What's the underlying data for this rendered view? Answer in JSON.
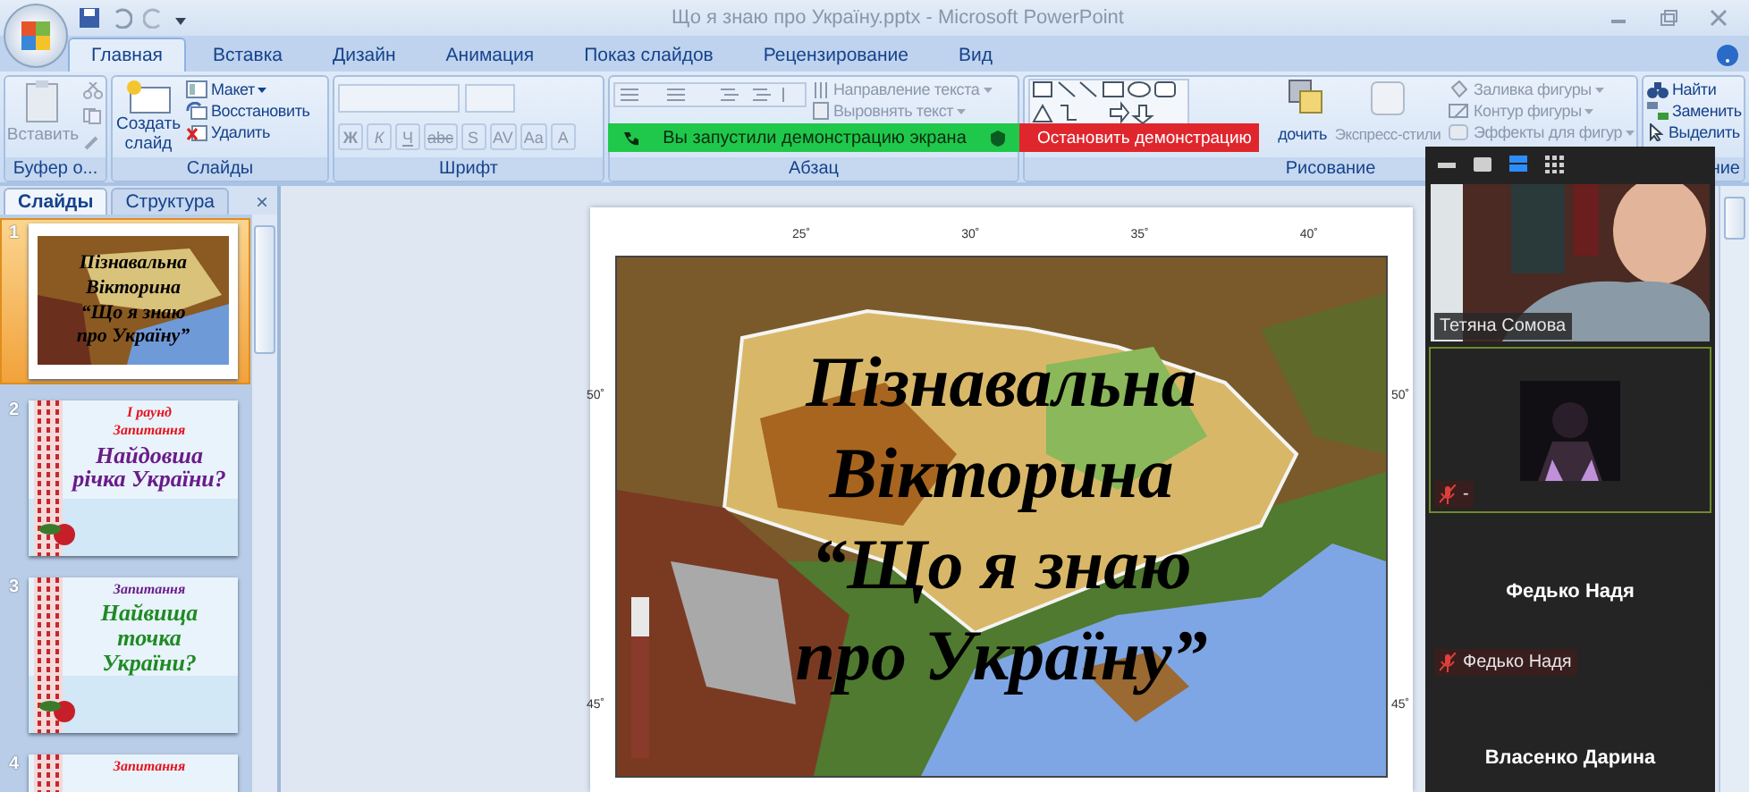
{
  "window": {
    "title": "Що я знаю про Україну.pptx - Microsoft PowerPoint"
  },
  "tabs": [
    {
      "label": "Главная",
      "selected": true
    },
    {
      "label": "Вставка",
      "selected": false
    },
    {
      "label": "Дизайн",
      "selected": false
    },
    {
      "label": "Анимация",
      "selected": false
    },
    {
      "label": "Показ слайдов",
      "selected": false
    },
    {
      "label": "Рецензирование",
      "selected": false
    },
    {
      "label": "Вид",
      "selected": false
    }
  ],
  "ribbon": {
    "groups": [
      {
        "kind": "clipboard",
        "label": "Буфер о...",
        "items": [
          {
            "label": "Вставить",
            "disabled": true
          }
        ]
      },
      {
        "kind": "slides",
        "label": "Слайды",
        "big": "Создать слайд",
        "items": [
          {
            "label": "Макет",
            "disabled": false
          },
          {
            "label": "Восстановить",
            "disabled": false
          },
          {
            "label": "Удалить",
            "disabled": false
          }
        ]
      },
      {
        "kind": "font",
        "label": "Шрифт",
        "items": [
          {
            "label": "Ж",
            "disabled": true
          },
          {
            "label": "К",
            "disabled": true
          },
          {
            "label": "Ч",
            "disabled": true
          },
          {
            "label": "abc",
            "disabled": true
          },
          {
            "label": "S",
            "disabled": true
          },
          {
            "label": "AV",
            "disabled": true
          },
          {
            "label": "Aa",
            "disabled": true
          },
          {
            "label": "A",
            "disabled": true
          }
        ]
      },
      {
        "kind": "paragraph",
        "label": "Абзац",
        "items": [
          {
            "label": "Направление текста",
            "disabled": true
          },
          {
            "label": "Выровнять текст",
            "disabled": true
          }
        ]
      },
      {
        "kind": "drawing",
        "label": "Рисование",
        "big": "дочить",
        "styles": "Экспресс-стили",
        "items": [
          {
            "label": "Заливка фигуры",
            "disabled": true
          },
          {
            "label": "Контур фигуры",
            "disabled": true
          },
          {
            "label": "Эффекты для фигур",
            "disabled": true
          }
        ]
      },
      {
        "kind": "editing",
        "label": "ние",
        "items": [
          {
            "label": "Найти",
            "disabled": false
          },
          {
            "label": "Заменить",
            "disabled": false
          },
          {
            "label": "Выделить",
            "disabled": false
          }
        ]
      }
    ]
  },
  "share_banner": {
    "message": "Вы запустили демонстрацию экрана",
    "stop": "Остановить демонстрацию"
  },
  "slides_panel": {
    "tabs": [
      {
        "label": "Слайды",
        "selected": true
      },
      {
        "label": "Структура",
        "selected": false
      }
    ],
    "close": "×",
    "slides": [
      {
        "number": "1",
        "selected": true,
        "kind": "map",
        "lines": [
          {
            "text": "Пізнавальна"
          },
          {
            "text": "Вікторина"
          },
          {
            "text": "“Що я знаю"
          },
          {
            "text": "про Україну”"
          }
        ]
      },
      {
        "number": "2",
        "selected": false,
        "kind": "ornament",
        "lines": [
          {
            "text": "І раунд",
            "color": "#e8101c"
          },
          {
            "text": "Запитання",
            "color": "#e8101c"
          },
          {
            "text": "Найдовша річка України?",
            "color": "#6a1b8a"
          }
        ]
      },
      {
        "number": "3",
        "selected": false,
        "kind": "ornament",
        "lines": [
          {
            "text": "Запитання",
            "color": "#6a1b8a"
          },
          {
            "text": "Найвища точка України?",
            "color": "#1f8a24"
          }
        ]
      },
      {
        "number": "4",
        "selected": false,
        "kind": "ornament",
        "lines": [
          {
            "text": "Запитання",
            "color": "#e8101c"
          }
        ]
      }
    ]
  },
  "slide": {
    "top_ticks": [
      "25˚",
      "30˚",
      "35˚",
      "40˚"
    ],
    "left_ticks": [
      "50˚",
      "45˚"
    ],
    "right_ticks": [
      "50˚",
      "45˚"
    ],
    "title_lines": [
      "Пізнавальна",
      "Вікторина",
      "“Що я знаю",
      "про Україну”"
    ]
  },
  "meeting": {
    "views": [
      {
        "kind": "minimize",
        "selected": false
      },
      {
        "kind": "single",
        "selected": false
      },
      {
        "kind": "speaker",
        "selected": true
      },
      {
        "kind": "gallery",
        "selected": false
      }
    ],
    "participants": [
      {
        "kind": "video",
        "label": "Тетяна Сомова",
        "muted": false,
        "active": false
      },
      {
        "kind": "avatar",
        "label": "-",
        "muted": true,
        "active": true
      },
      {
        "kind": "name",
        "display": "Федько Надя",
        "label": "Федько Надя",
        "muted": true,
        "active": false
      },
      {
        "kind": "name",
        "display": "Власенко Дарина",
        "active": false
      }
    ]
  }
}
